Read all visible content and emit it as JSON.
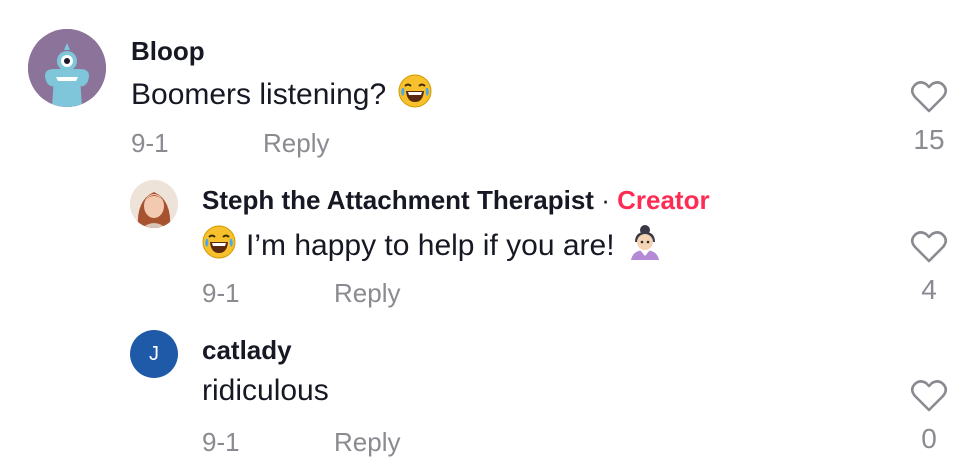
{
  "comments": [
    {
      "username": "Bloop",
      "text": "Boomers listening?",
      "text_emoji": "laughing-tears-emoji",
      "date": "9-1",
      "reply_label": "Reply",
      "likes": "15"
    },
    {
      "username": "Steph the Attachment Therapist",
      "separator": "·",
      "badge": "Creator",
      "text": "I’m happy to help if you are!",
      "leading_emoji": "laughing-tears-emoji",
      "trailing_emoji": "woman-old-emoji",
      "date": "9-1",
      "reply_label": "Reply",
      "likes": "4"
    },
    {
      "username": "catlady",
      "avatar_letter": "J",
      "text": "ridiculous",
      "date": "9-1",
      "reply_label": "Reply",
      "likes": "0"
    }
  ],
  "colors": {
    "creator": "#fe2c55",
    "muted": "#8a8b91",
    "avatar_blue": "#1e5aa8",
    "avatar_purple": "#8c7399"
  }
}
